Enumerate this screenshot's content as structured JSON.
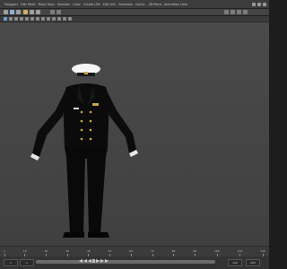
{
  "menu": {
    "items": [
      "Polygons",
      "Edit Mesh",
      "Mesh Tools",
      "Normals",
      "Color",
      "Create UVs",
      "Edit UVs",
      "Generate",
      "Cache",
      "-3D Paint",
      "Animation Help"
    ]
  },
  "toolbar": {
    "buttons": [
      {
        "name": "select-tool",
        "color": "#a0a0a0"
      },
      {
        "name": "lasso-tool",
        "color": "#8fb0d8"
      },
      {
        "name": "paint-select-tool",
        "color": "#a0a0a0"
      },
      {
        "name": "move-tool",
        "color": "#d0b060"
      },
      {
        "name": "rotate-tool",
        "color": "#a0a0a0"
      },
      {
        "name": "scale-tool",
        "color": "#a0a0a0"
      }
    ]
  },
  "timeline": {
    "ticks": [
      "1",
      "10",
      "20",
      "30",
      "40",
      "50",
      "60",
      "70",
      "80",
      "90",
      "100",
      "110",
      "120"
    ],
    "current_frame": "1"
  },
  "range": {
    "start": "1",
    "inner_start": "1",
    "inner_end": "120",
    "end": "200"
  },
  "viewport": {
    "bg": "#444444",
    "uniform_color": "#0a0a0a",
    "gold_color": "#c9a84c",
    "cap_color": "#f2f2f2"
  }
}
